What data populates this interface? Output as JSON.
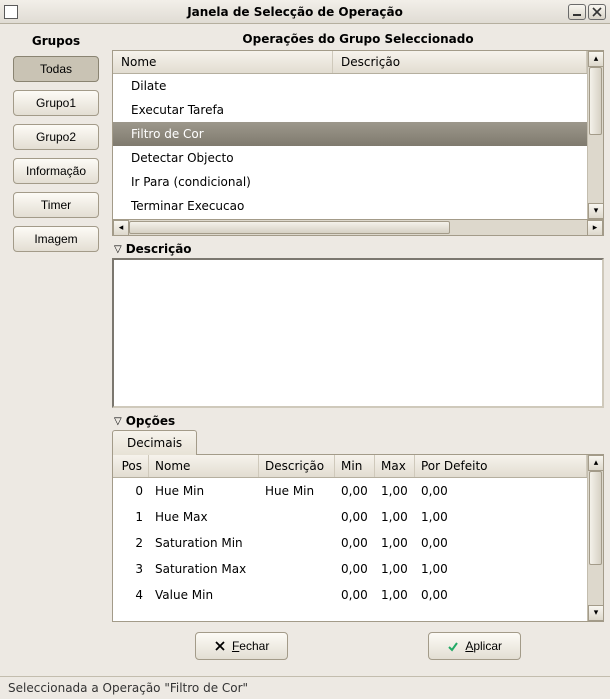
{
  "window": {
    "title": "Janela de Selecção de Operação"
  },
  "sidebar": {
    "title": "Grupos",
    "buttons": [
      {
        "label": "Todas",
        "active": true
      },
      {
        "label": "Grupo1",
        "active": false
      },
      {
        "label": "Grupo2",
        "active": false
      },
      {
        "label": "Informação",
        "active": false
      },
      {
        "label": "Timer",
        "active": false
      },
      {
        "label": "Imagem",
        "active": false
      }
    ]
  },
  "ops": {
    "title": "Operações do Grupo Seleccionado",
    "columns": {
      "nome": "Nome",
      "descricao": "Descrição"
    },
    "rows": [
      {
        "nome": "Dilate",
        "selected": false
      },
      {
        "nome": "Executar Tarefa",
        "selected": false
      },
      {
        "nome": "Filtro de Cor",
        "selected": true
      },
      {
        "nome": "Detectar Objecto",
        "selected": false
      },
      {
        "nome": "Ir Para (condicional)",
        "selected": false
      },
      {
        "nome": "Terminar Execucao",
        "selected": false
      }
    ]
  },
  "descSection": {
    "title": "Descrição"
  },
  "optSection": {
    "title": "Opções",
    "tab": "Decimais",
    "columns": {
      "pos": "Pos",
      "nome": "Nome",
      "desc": "Descrição",
      "min": "Min",
      "max": "Max",
      "def": "Por Defeito"
    },
    "rows": [
      {
        "pos": "0",
        "nome": "Hue Min",
        "desc": "Hue Min",
        "min": "0,00",
        "max": "1,00",
        "def": "0,00"
      },
      {
        "pos": "1",
        "nome": "Hue Max",
        "desc": "",
        "min": "0,00",
        "max": "1,00",
        "def": "1,00"
      },
      {
        "pos": "2",
        "nome": "Saturation Min",
        "desc": "",
        "min": "0,00",
        "max": "1,00",
        "def": "0,00"
      },
      {
        "pos": "3",
        "nome": "Saturation Max",
        "desc": "",
        "min": "0,00",
        "max": "1,00",
        "def": "1,00"
      },
      {
        "pos": "4",
        "nome": "Value Min",
        "desc": "",
        "min": "0,00",
        "max": "1,00",
        "def": "0,00"
      }
    ]
  },
  "buttons": {
    "close": "Fechar",
    "apply": "Aplicar"
  },
  "status": "Seleccionada a Operação \"Filtro de Cor\""
}
